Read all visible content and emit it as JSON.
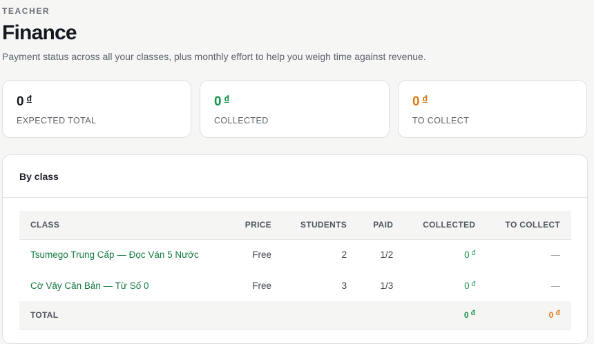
{
  "header": {
    "eyebrow": "TEACHER",
    "title": "Finance",
    "subtitle": "Payment status across all your classes, plus monthly effort to help you weigh time against revenue."
  },
  "kpis": [
    {
      "value": "0",
      "currency": "đ",
      "label": "EXPECTED TOTAL"
    },
    {
      "value": "0",
      "currency": "đ",
      "label": "COLLECTED"
    },
    {
      "value": "0",
      "currency": "đ",
      "label": "TO COLLECT"
    }
  ],
  "by_class": {
    "title": "By class",
    "columns": [
      "CLASS",
      "PRICE",
      "STUDENTS",
      "PAID",
      "COLLECTED",
      "TO COLLECT"
    ],
    "rows": [
      {
        "class": "Tsumego Trung Cấp — Đọc Ván 5 Nước",
        "price": "Free",
        "students": "2",
        "paid": "1/2",
        "collected": "0",
        "currency": "đ",
        "to_collect": "—"
      },
      {
        "class": "Cờ Vây Căn Bản — Từ Số 0",
        "price": "Free",
        "students": "3",
        "paid": "1/3",
        "collected": "0",
        "currency": "đ",
        "to_collect": "—"
      }
    ],
    "total": {
      "label": "TOTAL",
      "collected": "0",
      "to_collect": "0",
      "currency": "đ"
    }
  },
  "colors": {
    "accent_green": "#14934a",
    "accent_orange": "#dc7a14",
    "link_green": "#127a3f"
  }
}
